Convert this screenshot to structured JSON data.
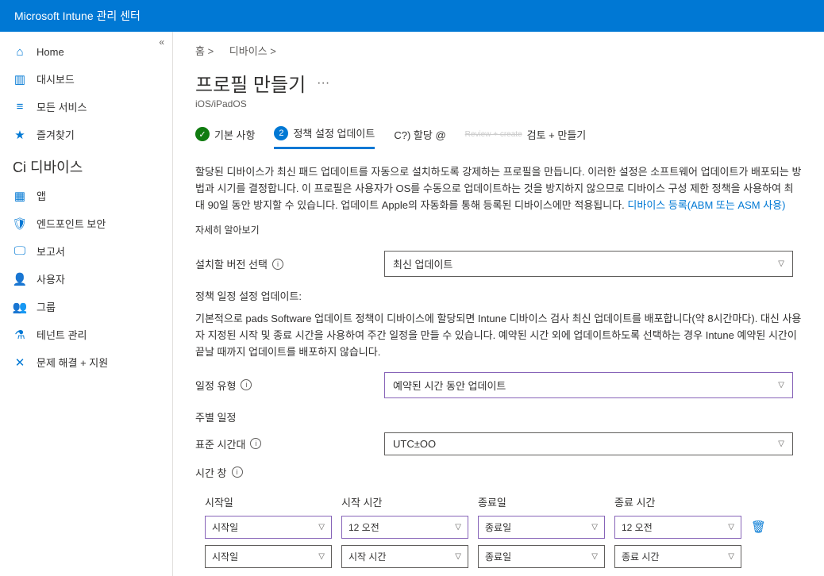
{
  "header": {
    "title": "Microsoft Intune 관리 센터"
  },
  "sidebar": {
    "items": [
      {
        "label": "Home",
        "icon": "🏠"
      },
      {
        "label": "대시보드",
        "icon": "📊"
      },
      {
        "label": "모든 서비스",
        "icon": "☰"
      },
      {
        "label": "즐겨찾기",
        "icon": "★"
      }
    ],
    "devices_header": "디바이스",
    "devices_prefix": "Ci",
    "sub_items": [
      {
        "label": "앱",
        "icon": "▦"
      },
      {
        "label": "엔드포인트 보안",
        "icon": "🛡"
      },
      {
        "label": "보고서",
        "icon": "🖥"
      },
      {
        "label": "사용자",
        "icon": "👤"
      },
      {
        "label": "그룹",
        "icon": "👥"
      },
      {
        "label": "테넌트 관리",
        "icon": "⚙"
      },
      {
        "label": "문제 해결 + 지원",
        "icon": "🔧"
      }
    ]
  },
  "breadcrumb": {
    "home": "홈 >",
    "devices": "디바이스 >"
  },
  "page": {
    "title": "프로필 만들기",
    "subtitle": "iOS/iPadOS",
    "menu": "···"
  },
  "wizard": {
    "step1": "기본 사항",
    "step2": "정책 설정 업데이트",
    "step3": "C?) 할당 @",
    "step4_sub": "Review + create",
    "step4": "검토 + 만들기"
  },
  "description": {
    "text": "할당된 디바이스가 최신 패드 업데이트를 자동으로 설치하도록 강제하는 프로필을 만듭니다. 이러한 설정은 소프트웨어 업데이트가 배포되는 방법과 시기를 결정합니다. 이 프로필은 사용자가 OS를 수동으로 업데이트하는 것을 방지하지 않으므로 디바이스 구성 제한 정책을 사용하여 최대 90일 동안 방지할 수 있습니다. 업데이트 Apple의 자동화를 통해 등록된 디바이스에만 적용됩니다.",
    "link_text": "디바이스 등록(ABM 또는 ASM 사용)",
    "learn_more": "자세히 알아보기"
  },
  "form": {
    "version_label": "설치할 버전 선택",
    "version_value": "최신 업데이트",
    "schedule_header": "정책 일정 설정 업데이트:",
    "schedule_desc": "기본적으로 pads Software 업데이트 정책이 디바이스에 할당되면 Intune 디바이스 검사 최신 업데이트를 배포합니다(약 8시간마다). 대신 사용자 지정된 시작 및 종료 시간을 사용하여 주간 일정을 만들 수 있습니다. 예약된 시간 외에 업데이트하도록 선택하는 경우 Intune 예약된 시간이 끝날 때까지 업데이트를 배포하지 않습니다.",
    "schedule_type_label": "일정 유형",
    "schedule_type_value": "예약된 시간 동안 업데이트",
    "weekly_label": "주별 일정",
    "timezone_label": "표준 시간대",
    "timezone_value": "UTC±OO",
    "timewindow_label": "시간 창"
  },
  "table": {
    "headers": {
      "start_day": "시작일",
      "start_time": "시작 시간",
      "end_day": "종료일",
      "end_time": "종료 시간"
    },
    "rows": [
      {
        "start_day": "시작일",
        "start_time": "12 오전",
        "end_day": "종료일",
        "end_time": "12 오전",
        "deletable": true
      },
      {
        "start_day": "시작일",
        "start_time": "시작 시간",
        "end_day": "종료일",
        "end_time": "종료 시간",
        "deletable": false
      }
    ]
  }
}
